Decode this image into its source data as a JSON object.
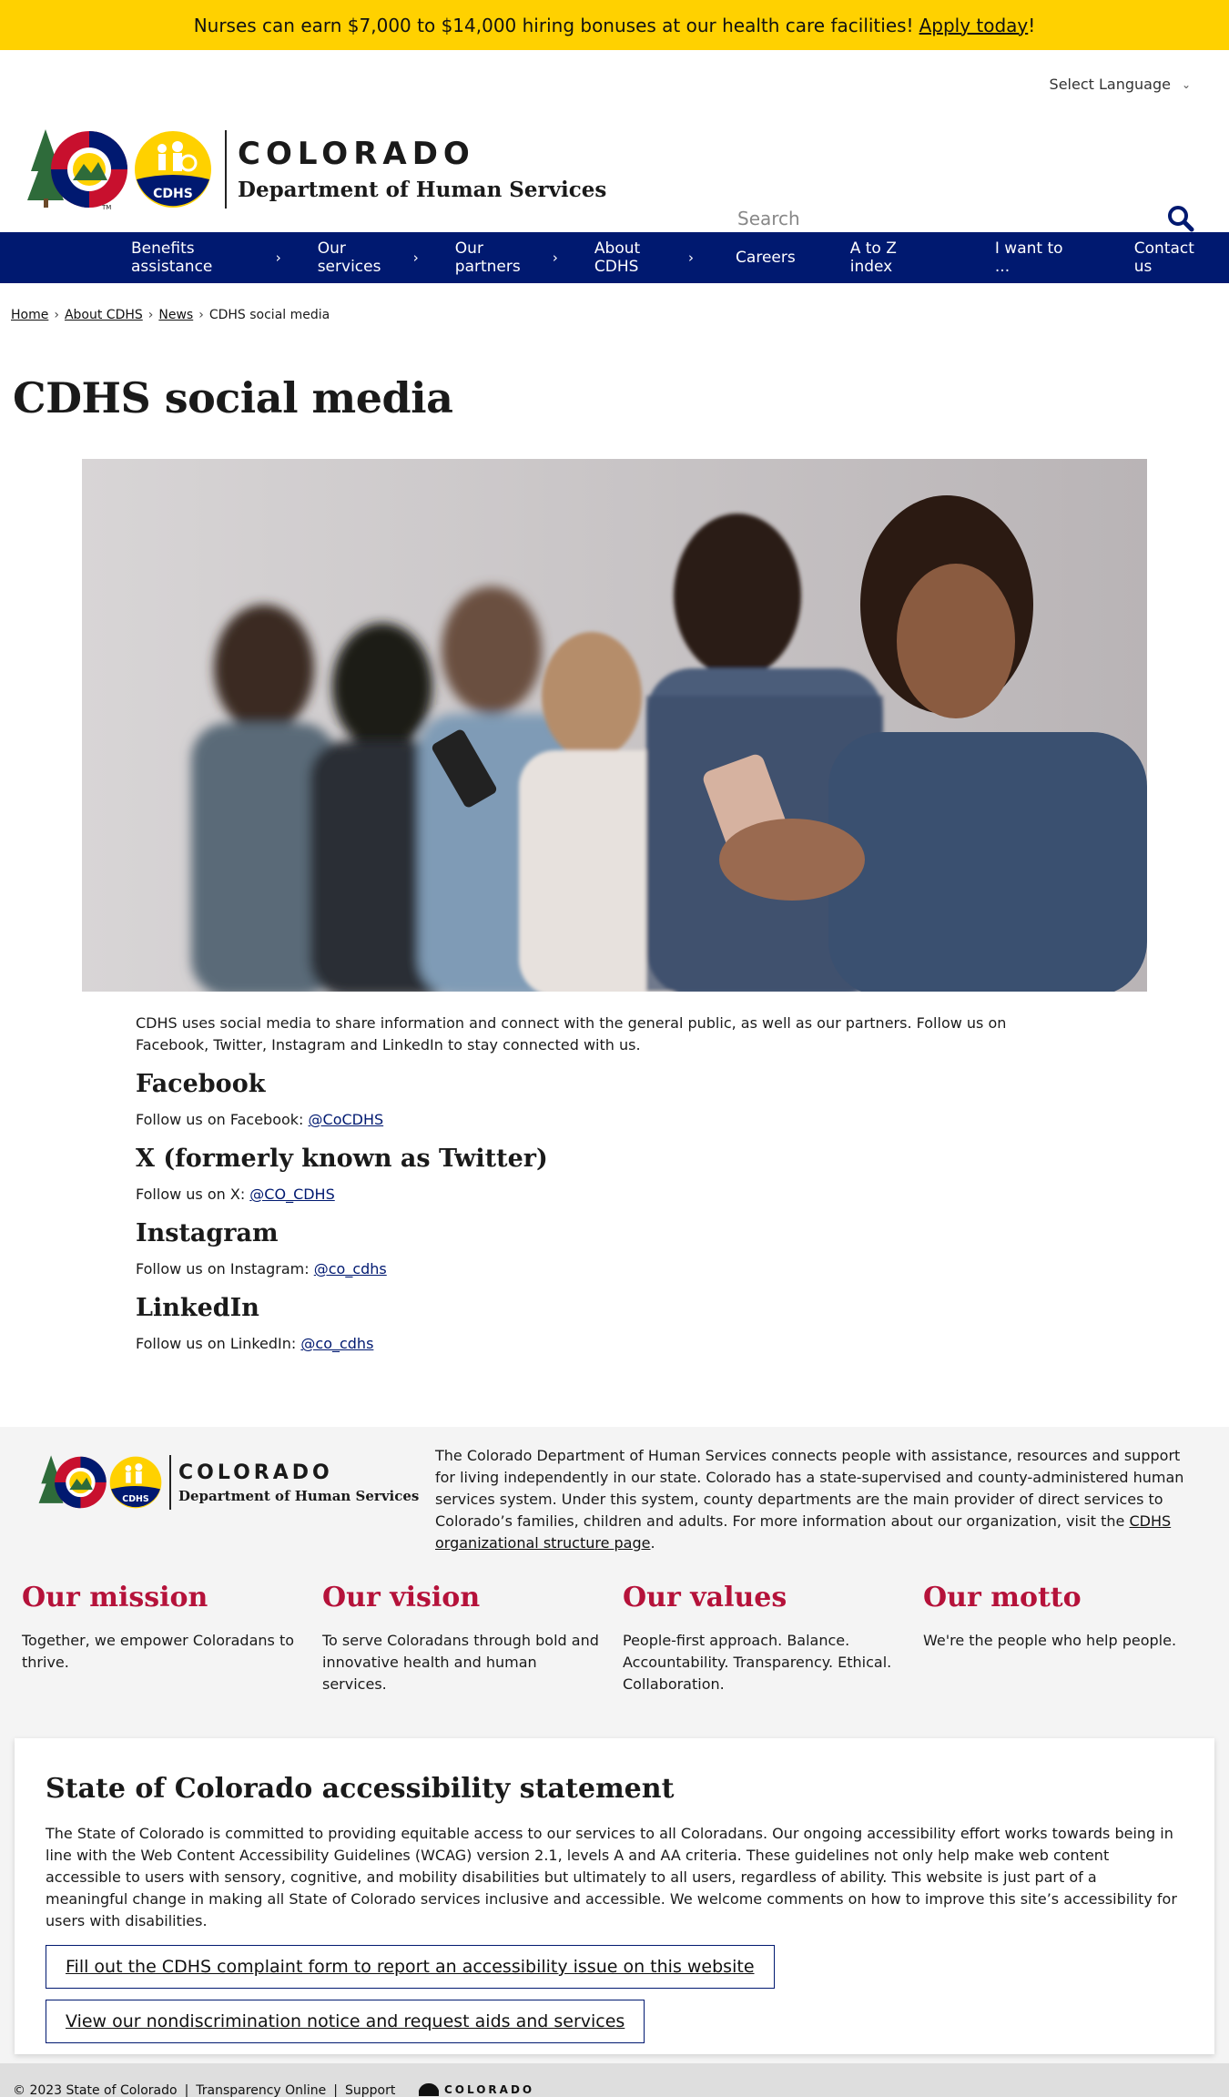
{
  "alert": {
    "text": "Nurses can earn $7,000 to $14,000 hiring bonuses at our health care facilities!",
    "link": "Apply today",
    "suffix": "!"
  },
  "header": {
    "language_select": "Select Language",
    "logo": {
      "title": "COLORADO",
      "subtitle": "Department of Human Services",
      "badge": "CDHS"
    },
    "search": {
      "placeholder": "Search"
    }
  },
  "nav": {
    "items": [
      {
        "label": "Benefits assistance",
        "has_children": true
      },
      {
        "label": "Our services",
        "has_children": true
      },
      {
        "label": "Our partners",
        "has_children": true
      },
      {
        "label": "About CDHS",
        "has_children": true
      },
      {
        "label": "Careers",
        "has_children": false
      },
      {
        "label": "A to Z index",
        "has_children": false
      },
      {
        "label": "I want to ...",
        "has_children": false
      },
      {
        "label": "Contact us",
        "has_children": false
      }
    ]
  },
  "breadcrumb": [
    "Home",
    "About CDHS",
    "News",
    "CDHS social media"
  ],
  "page_title": "CDHS social media",
  "content": {
    "intro": "CDHS uses social media to share information and connect with the general public, as well as our partners. Follow us on Facebook, Twitter, Instagram and LinkedIn to stay connected with us.",
    "sections": [
      {
        "heading": "Facebook",
        "text": "Follow us on Facebook: ",
        "handle": "@CoCDHS"
      },
      {
        "heading": "X (formerly known as Twitter)",
        "text": "Follow us on X: ",
        "handle": "@CO_CDHS"
      },
      {
        "heading": "Instagram",
        "text": "Follow us on Instagram: ",
        "handle": "@co_cdhs"
      },
      {
        "heading": "LinkedIn",
        "text": "Follow us on LinkedIn: ",
        "handle": "@co_cdhs"
      }
    ]
  },
  "footer": {
    "logo": {
      "title": "COLORADO",
      "subtitle": "Department of Human Services",
      "badge": "CDHS"
    },
    "about": "The Colorado Department of Human Services connects people with assistance, resources and support for living independently in our state. Colorado has a state-supervised and county-administered human services system. Under this system, county departments are the main provider of direct services to Colorado’s families, children and adults. For more information about our organization, visit the ",
    "about_link": "CDHS organizational structure page",
    "about_suffix": ".",
    "columns": [
      {
        "heading": "Our mission",
        "text": "Together, we empower Coloradans to thrive."
      },
      {
        "heading": "Our vision",
        "text": "To serve Coloradans through bold and innovative health and human services."
      },
      {
        "heading": "Our values",
        "text": "People-first approach. Balance. Accountability. Transparency. Ethical. Collaboration."
      },
      {
        "heading": "Our motto",
        "text": "We're the people who help people."
      }
    ],
    "accessibility": {
      "heading": "State of Colorado accessibility statement",
      "text": "The State of Colorado is committed to providing equitable access to our services to all Coloradans. Our ongoing accessibility effort works towards being in line with the Web Content Accessibility Guidelines (WCAG) version 2.1, levels A and AA criteria. These guidelines not only help make web content accessible to users with sensory, cognitive, and mobility disabilities but ultimately to all users, regardless of ability. This website is just part of a meaningful change in making all State of Colorado services inclusive and accessible. We welcome comments on how to improve this site’s accessibility for users with disabilities.",
      "button_complaint": "Fill out the CDHS complaint form to report an accessibility issue on this website",
      "button_nondiscrimination": "View our nondiscrimination notice and request aids and services"
    },
    "bottom": {
      "copyright": "© 2023 State of Colorado",
      "links": [
        "Transparency Online",
        "Support"
      ],
      "brand": "COLORADO"
    }
  },
  "colors": {
    "alert_bg": "#ffd100",
    "nav_bg": "#001970",
    "accent_red": "#b5123a",
    "footer_bg": "#f4f4f4"
  }
}
